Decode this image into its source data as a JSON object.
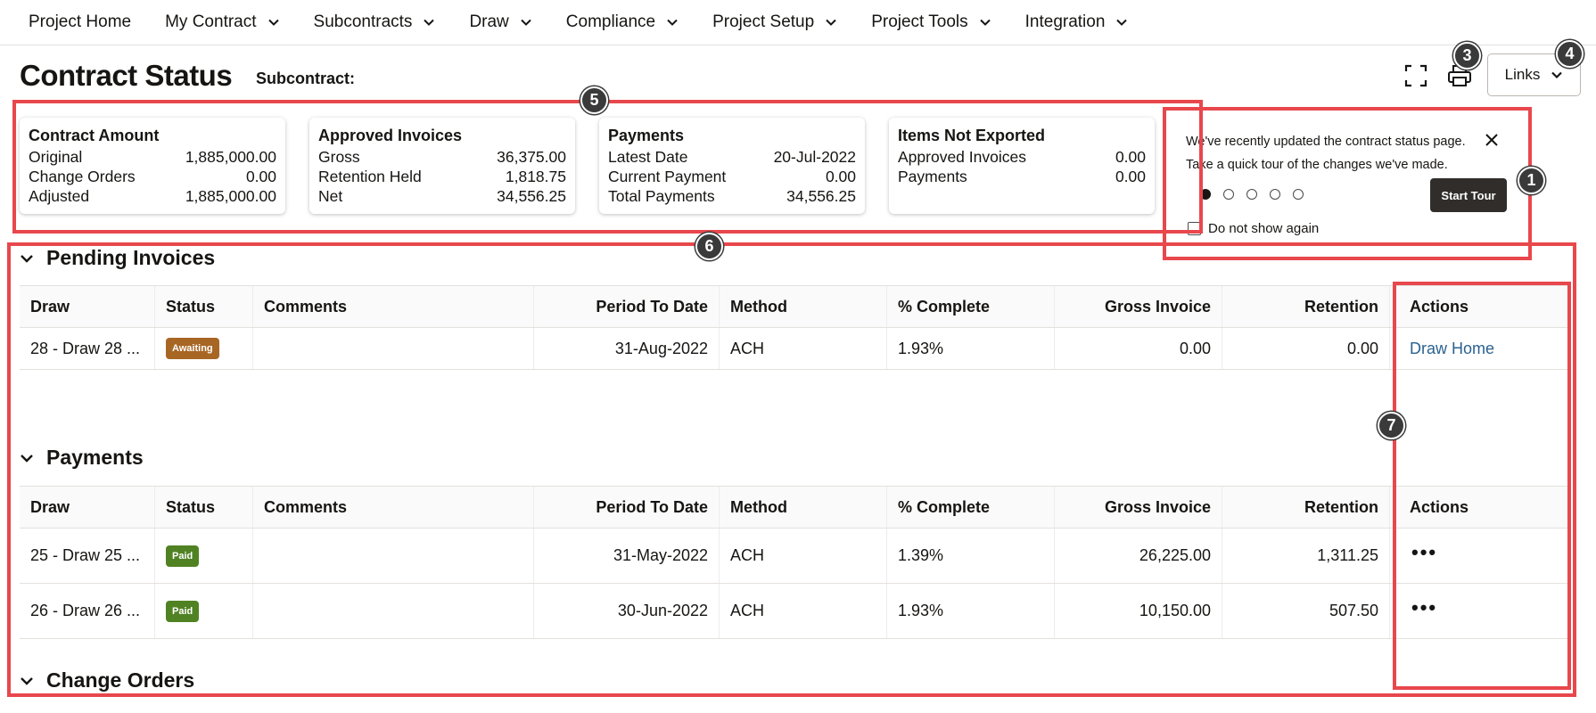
{
  "nav": {
    "items": [
      {
        "label": "Project Home",
        "dropdown": false
      },
      {
        "label": "My Contract",
        "dropdown": true
      },
      {
        "label": "Subcontracts",
        "dropdown": true
      },
      {
        "label": "Draw",
        "dropdown": true
      },
      {
        "label": "Compliance",
        "dropdown": true
      },
      {
        "label": "Project Setup",
        "dropdown": true
      },
      {
        "label": "Project Tools",
        "dropdown": true
      },
      {
        "label": "Integration",
        "dropdown": true
      }
    ]
  },
  "header": {
    "title": "Contract Status",
    "subcontract_label": "Subcontract:",
    "links_label": "Links",
    "icons": [
      "expand-icon",
      "print-icon",
      "chevron-down-icon"
    ]
  },
  "cards": [
    {
      "title": "Contract Amount",
      "rows": [
        {
          "label": "Original",
          "value": "1,885,000.00"
        },
        {
          "label": "Change Orders",
          "value": "0.00"
        },
        {
          "label": "Adjusted",
          "value": "1,885,000.00"
        }
      ]
    },
    {
      "title": "Approved Invoices",
      "rows": [
        {
          "label": "Gross",
          "value": "36,375.00"
        },
        {
          "label": "Retention Held",
          "value": "1,818.75"
        },
        {
          "label": "Net",
          "value": "34,556.25"
        }
      ]
    },
    {
      "title": "Payments",
      "rows": [
        {
          "label": "Latest Date",
          "value": "20-Jul-2022"
        },
        {
          "label": "Current Payment",
          "value": "0.00"
        },
        {
          "label": "Total Payments",
          "value": "34,556.25"
        }
      ]
    },
    {
      "title": "Items Not Exported",
      "rows": [
        {
          "label": "Approved Invoices",
          "value": "0.00"
        },
        {
          "label": "Payments",
          "value": "0.00"
        }
      ]
    }
  ],
  "tour": {
    "line1": "We've recently updated the contract status page.",
    "line2": "Take a quick tour of the changes we've made.",
    "start_label": "Start Tour",
    "do_not_show_label": "Do not show again",
    "steps": 5,
    "active_step": 1
  },
  "columns": [
    "Draw",
    "Status",
    "Comments",
    "Period To Date",
    "Method",
    "% Complete",
    "Gross Invoice",
    "Retention",
    "Actions"
  ],
  "pending": {
    "title": "Pending Invoices",
    "rows": [
      {
        "draw": "28 - Draw 28 ...",
        "status": "Awaiting",
        "comments": "",
        "period": "31-Aug-2022",
        "method": "ACH",
        "complete": "1.93%",
        "gross": "0.00",
        "retention": "0.00",
        "action": "Draw Home"
      }
    ]
  },
  "payments": {
    "title": "Payments",
    "rows": [
      {
        "draw": "25 - Draw 25 ...",
        "status": "Paid",
        "comments": "",
        "period": "31-May-2022",
        "method": "ACH",
        "complete": "1.39%",
        "gross": "26,225.00",
        "retention": "1,311.25",
        "action": "•••"
      },
      {
        "draw": "26 - Draw 26 ...",
        "status": "Paid",
        "comments": "",
        "period": "30-Jun-2022",
        "method": "ACH",
        "complete": "1.93%",
        "gross": "10,150.00",
        "retention": "507.50",
        "action": "•••"
      }
    ]
  },
  "change_orders": {
    "title": "Change Orders"
  },
  "callouts": [
    "1",
    "3",
    "4",
    "5",
    "6",
    "7"
  ],
  "colors": {
    "highlight": "#e8474c",
    "awaiting": "#a86624",
    "paid": "#508223",
    "link": "#2b6290"
  }
}
